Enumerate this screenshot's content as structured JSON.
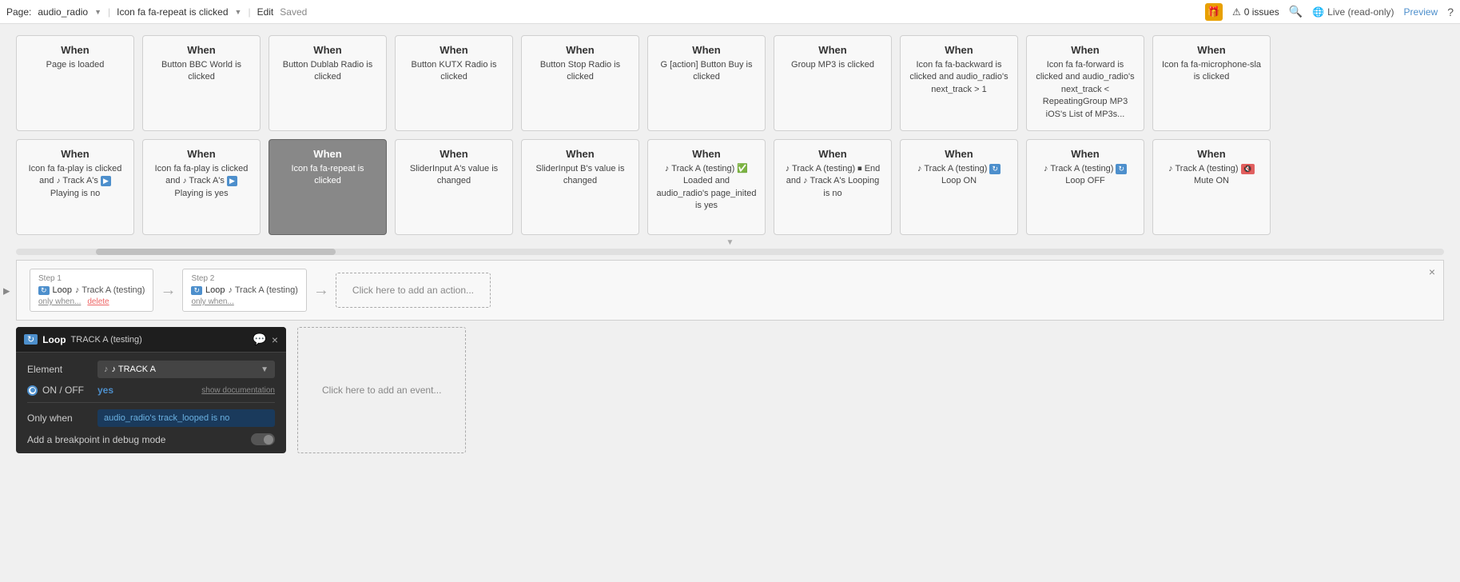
{
  "topbar": {
    "page_label": "Page:",
    "page_name": "audio_radio",
    "workflow_label": "Icon fa fa-repeat is clicked",
    "edit_label": "Edit",
    "saved_label": "Saved",
    "gift_icon": "🎁",
    "issues_count": "0 issues",
    "search_icon": "🔍",
    "globe_icon": "🌐",
    "live_label": "Live (read-only)",
    "preview_label": "Preview",
    "help_icon": "?"
  },
  "cards_row1": [
    {
      "title": "When",
      "body": "Page is loaded",
      "active": false
    },
    {
      "title": "When",
      "body": "Button BBC World is clicked",
      "active": false
    },
    {
      "title": "When",
      "body": "Button Dublab Radio is clicked",
      "active": false
    },
    {
      "title": "When",
      "body": "Button KUTX Radio is clicked",
      "active": false
    },
    {
      "title": "When",
      "body": "Button Stop Radio is clicked",
      "active": false
    },
    {
      "title": "When",
      "body": "G [action] Button Buy is clicked",
      "active": false
    },
    {
      "title": "When",
      "body": "Group MP3 is clicked",
      "active": false
    },
    {
      "title": "When",
      "body": "Icon fa fa-backward is clicked and audio_radio's next_track > 1",
      "active": false
    },
    {
      "title": "When",
      "body": "Icon fa fa-forward is clicked and audio_radio's next_track < RepeatingGroup MP3 iOS's List of MP3s...",
      "active": false
    },
    {
      "title": "When",
      "body": "Icon fa fa-microphone-sla is clicked",
      "active": false
    }
  ],
  "cards_row2": [
    {
      "title": "When",
      "body": "Icon fa fa-play is clicked and 🎵 Track A's ▶ Playing is no",
      "active": false
    },
    {
      "title": "When",
      "body": "Icon fa fa-play is clicked and 🎵 Track A's ▶ Playing is yes",
      "active": false
    },
    {
      "title": "When",
      "body": "Icon fa fa-repeat is clicked",
      "active": true
    },
    {
      "title": "When",
      "body": "SliderInput A's value is changed",
      "active": false
    },
    {
      "title": "When",
      "body": "SliderInput B's value is changed",
      "active": false
    },
    {
      "title": "When",
      "body": "🎵 Track A (testing) ✅ Loaded and audio_radio's page_inited is yes",
      "active": false
    },
    {
      "title": "When",
      "body": "🎵 Track A (testing) ⏹ End and 🎵 Track A's Looping is no",
      "active": false
    },
    {
      "title": "When",
      "body": "🎵 Track A (testing) 🔵 Loop ON",
      "active": false
    },
    {
      "title": "When",
      "body": "🎵 Track A (testing) 🔵 Loop OFF",
      "active": false
    },
    {
      "title": "When",
      "body": "🎵 Track A (testing) 🔴 Mute ON",
      "active": false
    }
  ],
  "workflow_detail": {
    "close_label": "×",
    "step1": {
      "label": "Step 1",
      "content": "Loop 🎵 Track A (testing)",
      "only_when": "only when...",
      "delete_label": "delete"
    },
    "step2": {
      "label": "Step 2",
      "content": "Loop 🎵 Track A (testing)",
      "only_when": "only when..."
    },
    "add_action_label": "Click here to add an action..."
  },
  "action_config": {
    "header": {
      "loop_icon": "↻",
      "title": "Loop",
      "subtitle": "TRACK A (testing)",
      "chat_icon": "💬",
      "close_icon": "×"
    },
    "element_label": "Element",
    "element_value": "♪ TRACK A",
    "on_off_label": "ON / OFF",
    "on_off_value": "yes",
    "show_doc_label": "show documentation",
    "only_when_label": "Only when",
    "only_when_value": "audio_radio's track_looped is no",
    "debug_label": "Add a breakpoint in debug mode"
  },
  "add_event": {
    "label": "Click here to add an event..."
  }
}
